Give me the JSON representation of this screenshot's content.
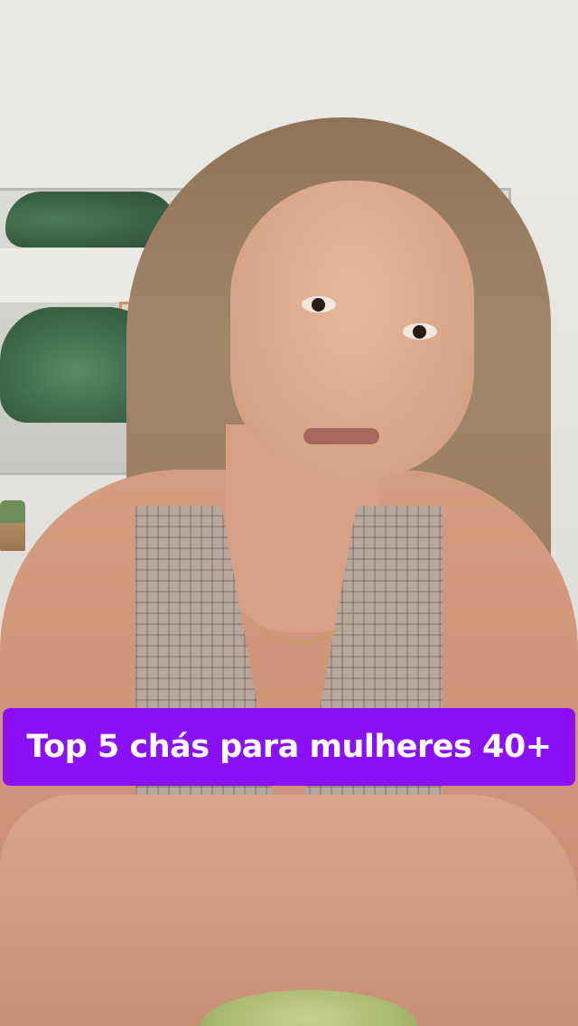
{
  "video": {
    "caption": "Top 5 chás para mulheres 40+",
    "caption_background_color": "#8b10f6",
    "caption_text_color": "#ffffff"
  }
}
